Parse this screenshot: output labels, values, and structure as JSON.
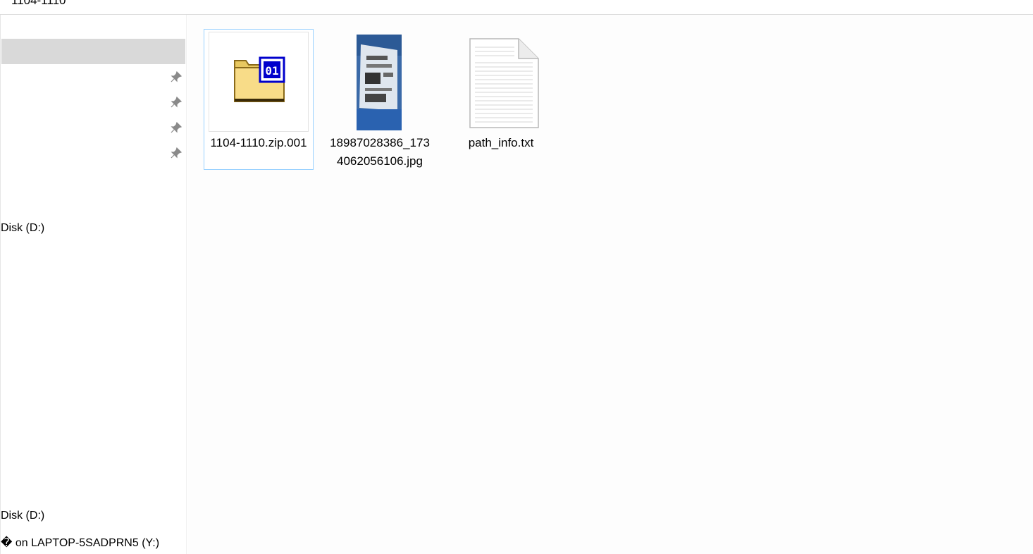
{
  "window": {
    "title": "1104-1110"
  },
  "sidebar": {
    "pins": [
      "pin-icon",
      "pin-icon",
      "pin-icon",
      "pin-icon"
    ],
    "items": [
      {
        "label": "Disk (D:)"
      },
      {
        "label": "Disk (D:)"
      },
      {
        "label": "� on LAPTOP-5SADPRN5 (Y:)"
      }
    ]
  },
  "files": [
    {
      "name": "1104-1110.zip.001",
      "icon": "archive-folder-icon",
      "badge": "01",
      "selected": true
    },
    {
      "name": "18987028386_1734062056106.jpg",
      "icon": "image-thumbnail",
      "selected": false
    },
    {
      "name": "path_info.txt",
      "icon": "text-file-icon",
      "selected": false
    }
  ],
  "colors": {
    "selection_border": "#99d1ff",
    "nav_selected": "#d9d9d9",
    "badge": "#0000cc"
  }
}
